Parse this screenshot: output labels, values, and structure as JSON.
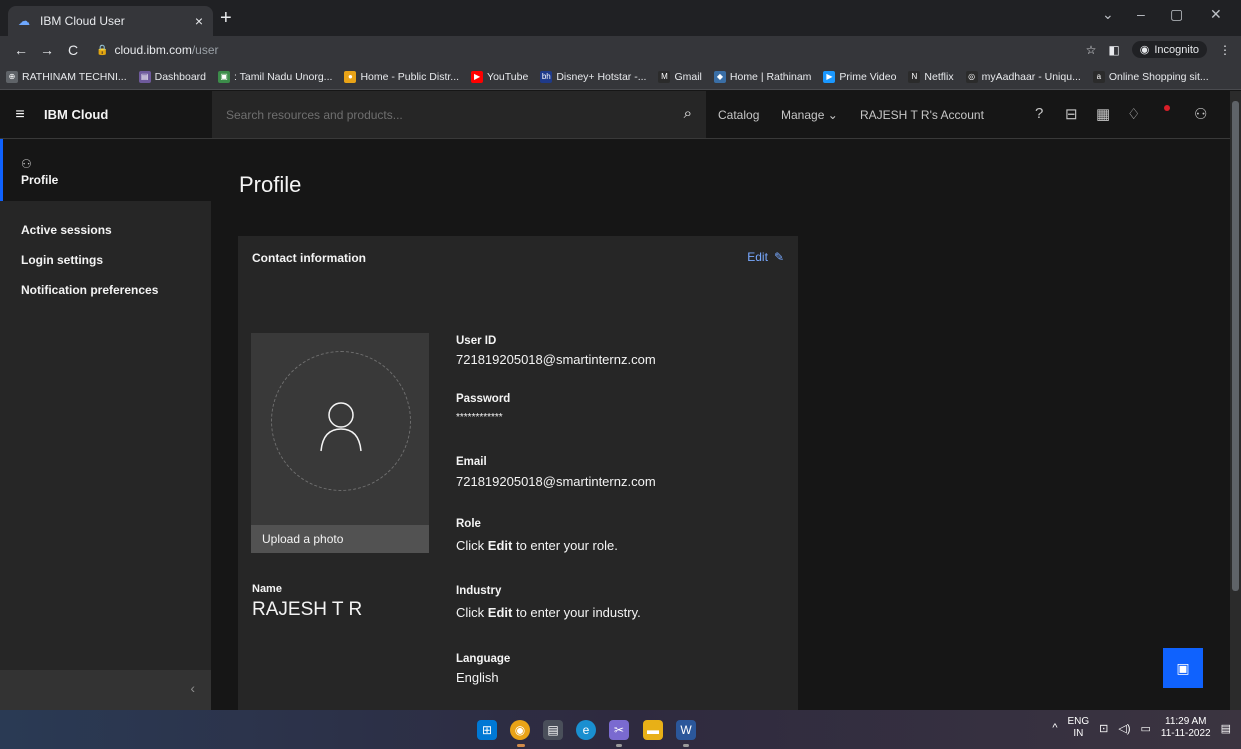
{
  "browser": {
    "tab_title": "IBM Cloud User",
    "tab_close": "×",
    "new_tab": "+",
    "url_host": "cloud.ibm.com",
    "url_path": "/user",
    "incognito_label": "Incognito",
    "window_controls": [
      "⌄",
      "–",
      "▢",
      "✕"
    ]
  },
  "bookmarks": [
    {
      "label": "RATHINAM TECHNI...",
      "color": "#5f6368",
      "glyph": "⊕"
    },
    {
      "label": "Dashboard",
      "color": "#6e5a9c",
      "glyph": "▤"
    },
    {
      "label": ": Tamil Nadu Unorg...",
      "color": "#3c8c4a",
      "glyph": "▣"
    },
    {
      "label": "Home - Public Distr...",
      "color": "#e8a317",
      "glyph": "●"
    },
    {
      "label": "YouTube",
      "color": "#ff0000",
      "glyph": "▶"
    },
    {
      "label": "Disney+ Hotstar -...",
      "color": "#1f3a8a",
      "glyph": "bh"
    },
    {
      "label": "Gmail",
      "color": "#2b2b2b",
      "glyph": "M"
    },
    {
      "label": "Home | Rathinam",
      "color": "#3a6ea5",
      "glyph": "◆"
    },
    {
      "label": "Prime Video",
      "color": "#1a98ff",
      "glyph": "▶"
    },
    {
      "label": "Netflix",
      "color": "#2b2b2b",
      "glyph": "N"
    },
    {
      "label": "myAadhaar - Uniqu...",
      "color": "#2b2b2b",
      "glyph": "◎"
    },
    {
      "label": "Online Shopping sit...",
      "color": "#2b2b2b",
      "glyph": "a"
    }
  ],
  "header": {
    "brand": "IBM Cloud",
    "search_placeholder": "Search resources and products...",
    "catalog": "Catalog",
    "manage": "Manage",
    "account": "RAJESH T R's Account"
  },
  "sidebar": {
    "items": [
      {
        "label": "Profile",
        "active": true
      },
      {
        "label": "Active sessions"
      },
      {
        "label": "Login settings"
      },
      {
        "label": "Notification preferences"
      }
    ],
    "collapse": "‹"
  },
  "main": {
    "page_title": "Profile",
    "card_title": "Contact information",
    "edit_label": "Edit",
    "upload_label": "Upload a photo",
    "name_label": "Name",
    "name_value": "RAJESH T R",
    "fields": [
      {
        "label": "User ID",
        "value": "721819205018@smartinternz.com"
      },
      {
        "label": "Password",
        "value": "************"
      },
      {
        "label": "Email",
        "value": "721819205018@smartinternz.com"
      },
      {
        "label": "Role",
        "value_prefix": "Click ",
        "value_bold": "Edit",
        "value_suffix": " to enter your role."
      },
      {
        "label": "Industry",
        "value_prefix": "Click ",
        "value_bold": "Edit",
        "value_suffix": " to enter your industry."
      },
      {
        "label": "Language",
        "value": "English"
      }
    ]
  },
  "taskbar": {
    "lang_top": "ENG",
    "lang_bottom": "IN",
    "time": "11:29 AM",
    "date": "11-11-2022"
  },
  "colors": {
    "accent": "#0f62fe",
    "link": "#78a9ff",
    "background": "#161616",
    "panel": "#262626"
  },
  "icons": [
    "search-icon",
    "help-icon",
    "cost-icon",
    "calculator-icon",
    "notification-icon",
    "user-icon",
    "edit-pencil-icon",
    "chat-icon"
  ]
}
